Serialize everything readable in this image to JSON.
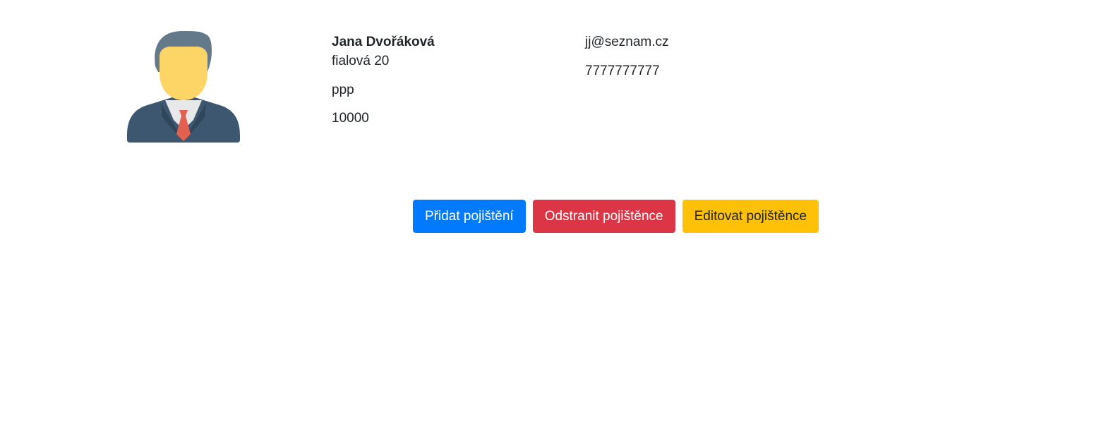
{
  "insured": {
    "name": "Jana Dvořáková",
    "street": "fialová 20",
    "city": "ppp",
    "zip": "10000",
    "email": "jj@seznam.cz",
    "phone": "7777777777"
  },
  "avatar": {
    "icon": "person-avatar-icon",
    "colors": {
      "hair": "#64798a",
      "face": "#fdd566",
      "suit": "#3e5770",
      "shirt": "#e6e8ea",
      "tie": "#e3604f"
    }
  },
  "actions": {
    "add_insurance": "Přidat pojištění",
    "remove_insured": "Odstranit pojištěnce",
    "edit_insured": "Editovat pojištěnce"
  },
  "colors": {
    "primary": "#007bff",
    "danger": "#dc3545",
    "warning": "#ffc107"
  }
}
